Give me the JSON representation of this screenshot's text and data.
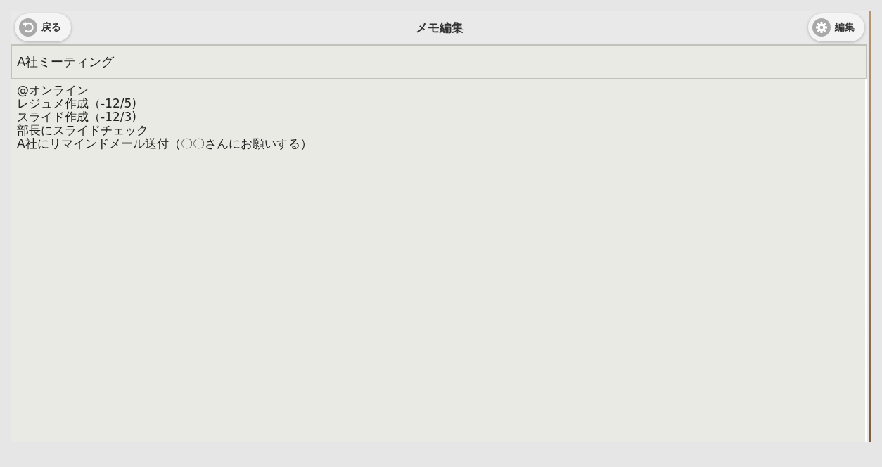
{
  "header": {
    "back_button": "戻る",
    "title": "メモ編集",
    "edit_button": "編集"
  },
  "memo_title": {
    "value": "A社ミーティング"
  },
  "memo_body": {
    "lines": [
      "@オンライン",
      "レジュメ作成（-12/5)",
      "スライド作成（-12/3)",
      "部長にスライドチェック",
      "A社にリマインドメール送付（〇〇さんにお願いする）"
    ]
  }
}
